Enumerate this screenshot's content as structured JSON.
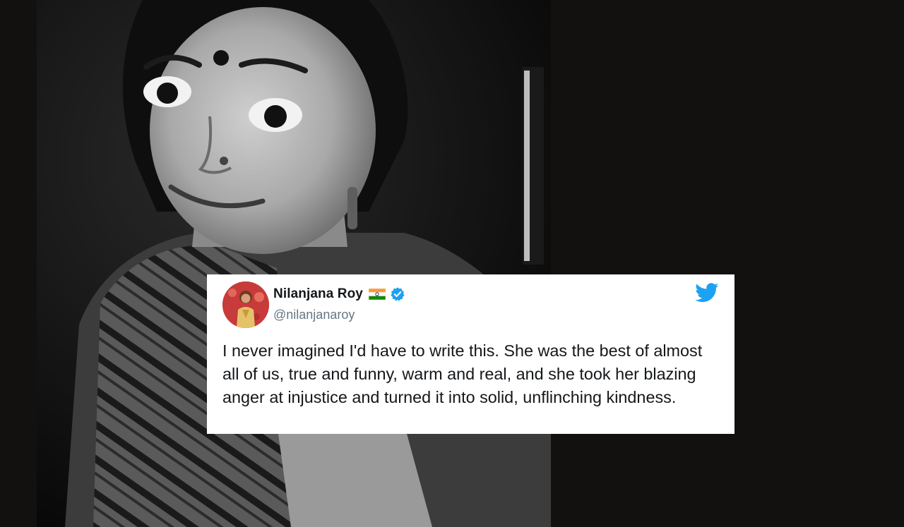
{
  "tweet": {
    "display_name": "Nilanjana Roy",
    "handle": "@nilanjanaroy",
    "text": "I never imagined I'd have to write this. She was the best of almost all of us, true and funny, warm and real, and she took her blazing anger at injustice and turned it into solid, unflinching kindness.",
    "flag_icon": "india-flag-icon",
    "verified_icon": "verified-badge-icon",
    "brand_icon": "twitter-bird-icon"
  },
  "colors": {
    "background": "#131010",
    "card": "#ffffff",
    "name": "#14171a",
    "handle": "#657786",
    "twitter_blue": "#1da1f2",
    "verified_blue": "#1da1f2",
    "avatar_bg": "#d23a3a"
  },
  "photo": {
    "description_icon": "portrait-photo",
    "style": "black-and-white"
  }
}
